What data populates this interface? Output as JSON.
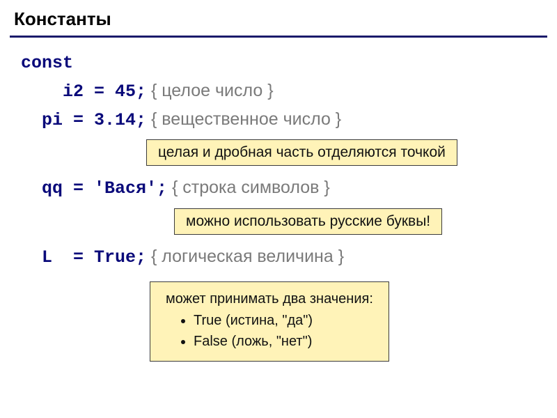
{
  "title": "Константы",
  "code": {
    "const_kw": "const",
    "line_i2_code": "    i2 = 45;",
    "line_i2_comment": " { целое число }",
    "line_pi_code": "  pi = 3.14;",
    "line_pi_comment": " { вещественное число }",
    "line_qq_code": "  qq = 'Вася';",
    "line_qq_comment": " { строка символов }",
    "line_L_code": "  L  = True;",
    "line_L_comment": " { логическая величина }"
  },
  "notes": {
    "decimal_point": "целая и дробная часть отделяются точкой",
    "russian_letters": "можно использовать русские буквы!",
    "bool_intro": "может принимать два значения:",
    "bool_true": "True (истина, \"да\")",
    "bool_false": "False (ложь, \"нет\")"
  }
}
